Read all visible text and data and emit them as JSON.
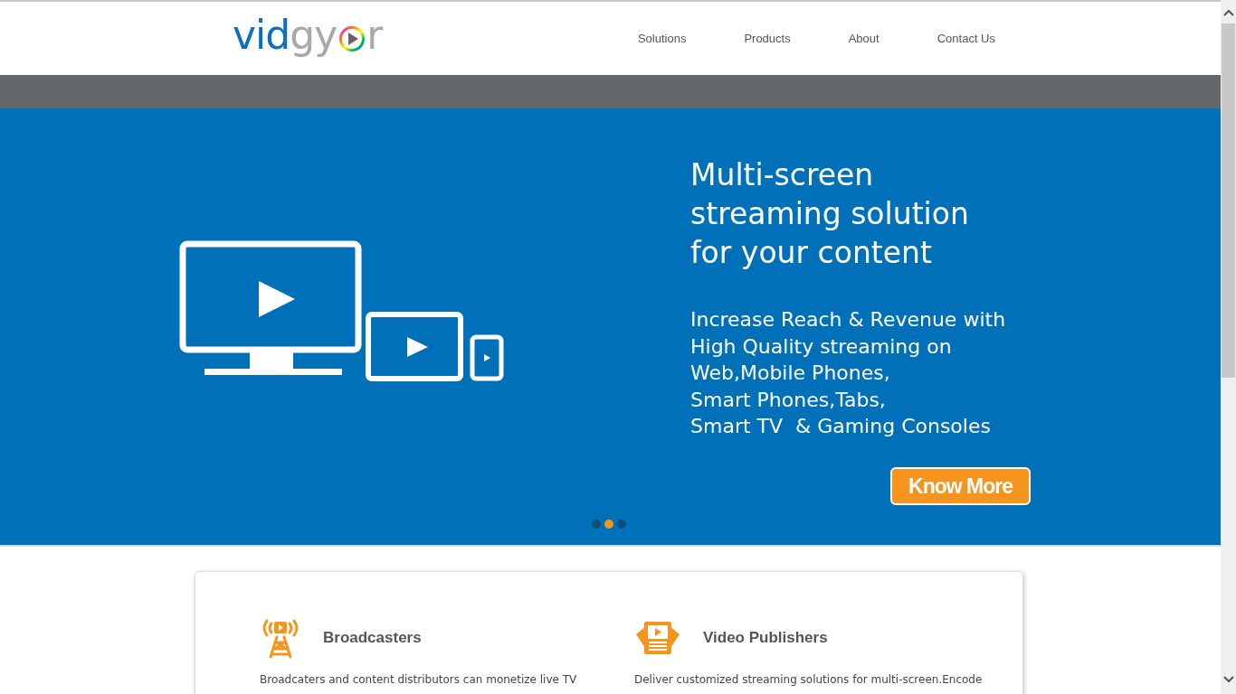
{
  "logo": {
    "lead": "vid",
    "mid": "gy",
    "tail": "r"
  },
  "nav": [
    {
      "label": "Solutions"
    },
    {
      "label": "Products"
    },
    {
      "label": "About"
    },
    {
      "label": "Contact Us"
    }
  ],
  "hero": {
    "headline": [
      "Multi-screen",
      "streaming solution",
      "for your content"
    ],
    "body": [
      "Increase Reach & Revenue with",
      "High Quality streaming on",
      "Web,Mobile Phones,",
      "Smart Phones,Tabs,",
      "Smart TV  & Gaming Consoles"
    ],
    "button": "Know More",
    "dots": [
      {
        "selected": false
      },
      {
        "selected": true
      },
      {
        "selected": false
      }
    ]
  },
  "features": [
    {
      "kind": "tower",
      "title": "Broadcasters",
      "text": "Broadcaters and content distributors can monetize live TV"
    },
    {
      "kind": "publisher",
      "title": "Video Publishers",
      "text": "Deliver customized streaming solutions for multi-screen.Encode"
    }
  ]
}
